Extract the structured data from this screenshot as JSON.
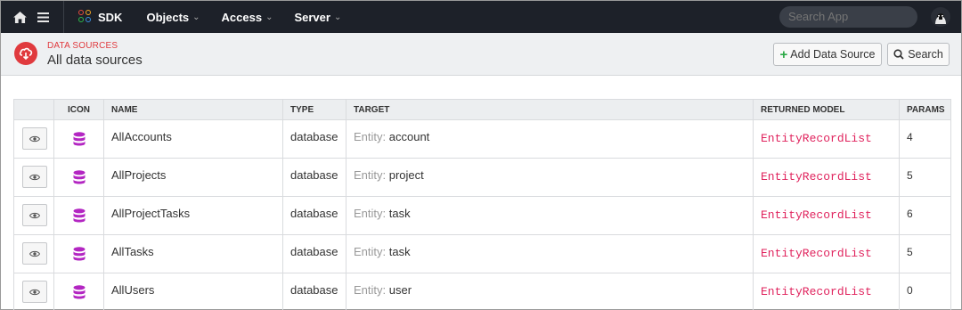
{
  "nav": {
    "home_icon": "home-icon",
    "menu_icon": "hamburger-icon",
    "brand": "SDK",
    "items": [
      {
        "label": "Objects"
      },
      {
        "label": "Access"
      },
      {
        "label": "Server"
      }
    ],
    "search_placeholder": "Search App"
  },
  "header": {
    "section": "DATA SOURCES",
    "title": "All data sources",
    "add_label": "Add Data Source",
    "search_label": "Search",
    "accent_color": "#e03a3e"
  },
  "table": {
    "columns": [
      "",
      "ICON",
      "NAME",
      "TYPE",
      "TARGET",
      "RETURNED MODEL",
      "PARAMS"
    ],
    "rows": [
      {
        "name": "AllAccounts",
        "type": "database",
        "target_prefix": "Entity:",
        "target": "account",
        "model": "EntityRecordList",
        "params": "4"
      },
      {
        "name": "AllProjects",
        "type": "database",
        "target_prefix": "Entity:",
        "target": "project",
        "model": "EntityRecordList",
        "params": "5"
      },
      {
        "name": "AllProjectTasks",
        "type": "database",
        "target_prefix": "Entity:",
        "target": "task",
        "model": "EntityRecordList",
        "params": "6"
      },
      {
        "name": "AllTasks",
        "type": "database",
        "target_prefix": "Entity:",
        "target": "task",
        "model": "EntityRecordList",
        "params": "5"
      },
      {
        "name": "AllUsers",
        "type": "database",
        "target_prefix": "Entity:",
        "target": "user",
        "model": "EntityRecordList",
        "params": "0"
      }
    ]
  }
}
